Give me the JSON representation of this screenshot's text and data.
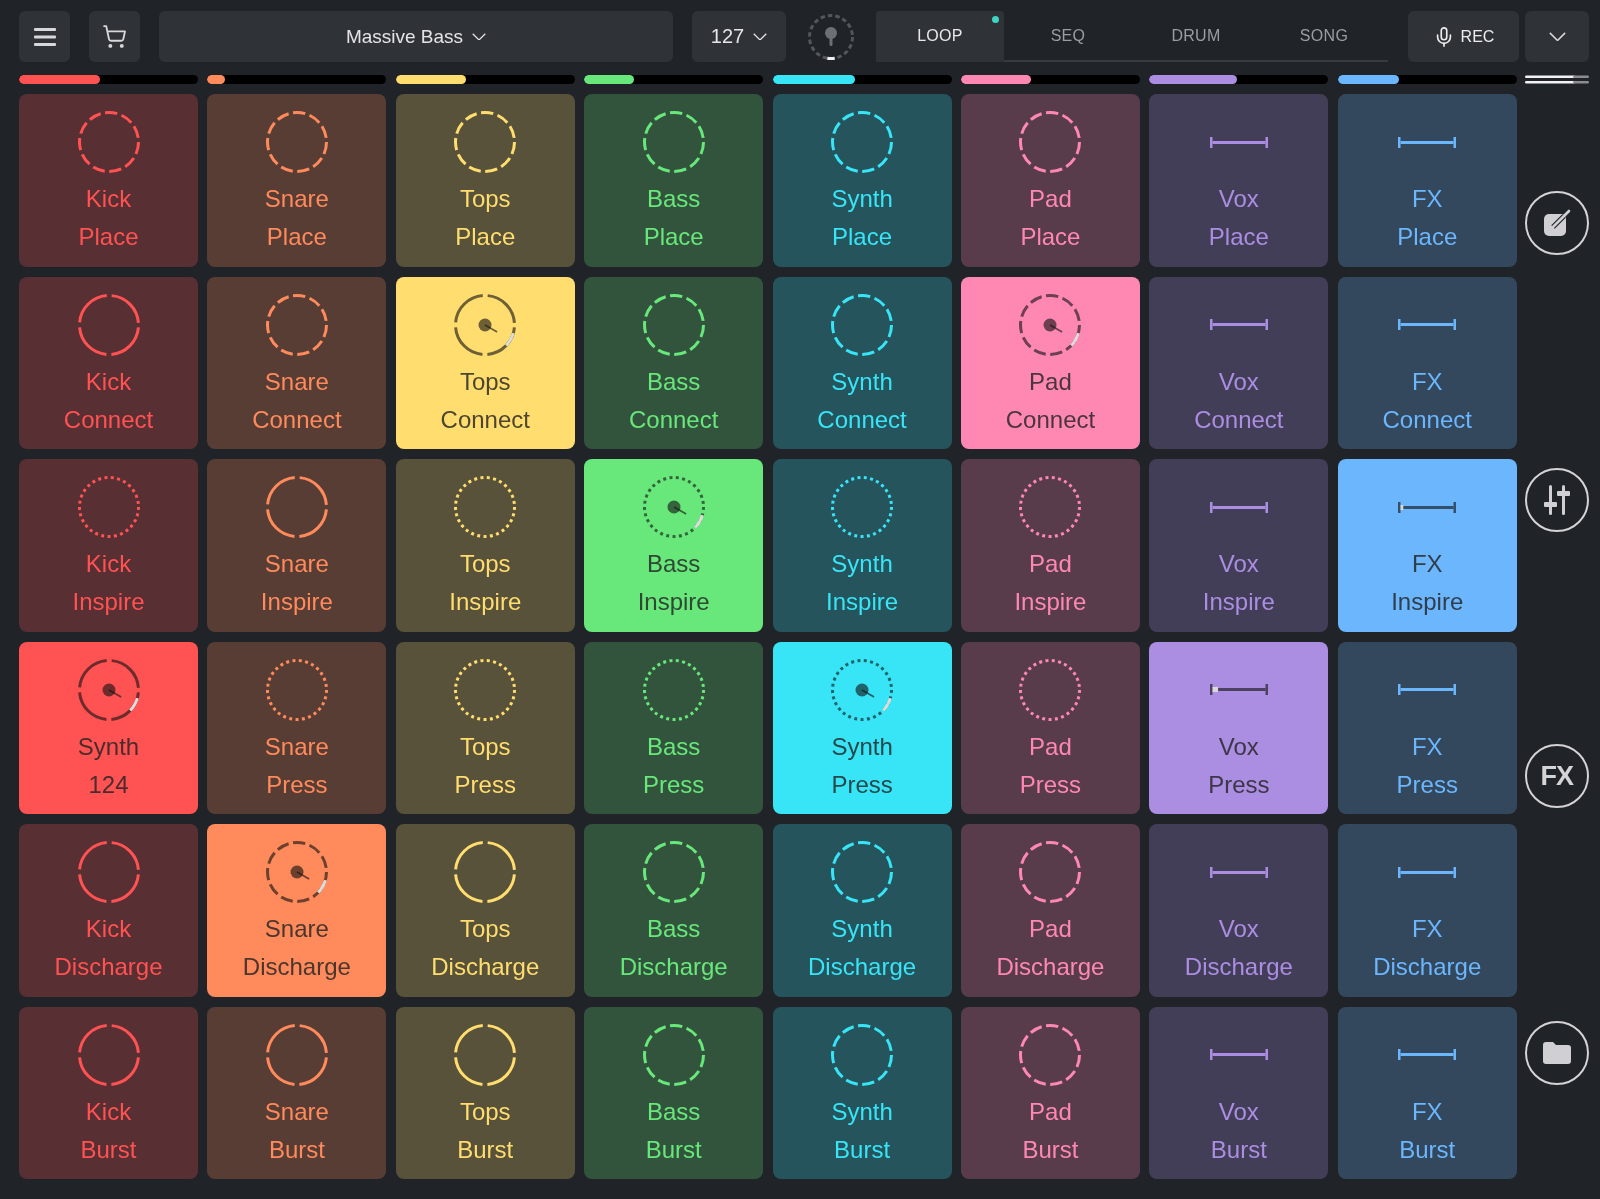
{
  "toolbar": {
    "preset": "Massive Bass",
    "tempo": "127",
    "tabs": [
      {
        "label": "LOOP",
        "selected": true,
        "notified": true
      },
      {
        "label": "SEQ",
        "selected": false,
        "notified": false
      },
      {
        "label": "DRUM",
        "selected": false,
        "notified": false
      },
      {
        "label": "SONG",
        "selected": false,
        "notified": false
      }
    ],
    "record": "REC"
  },
  "columns": [
    {
      "color": "#ff5252",
      "level": 0.45,
      "pads": [
        {
          "title": "Kick",
          "subtitle": "Place",
          "kind": "dashed",
          "selected": false
        },
        {
          "title": "Kick",
          "subtitle": "Connect",
          "kind": "arcs",
          "selected": false
        },
        {
          "title": "Kick",
          "subtitle": "Inspire",
          "kind": "dotted",
          "selected": false
        },
        {
          "title": "Synth",
          "subtitle": "124",
          "kind": "arcs",
          "selected": true
        },
        {
          "title": "Kick",
          "subtitle": "Discharge",
          "kind": "arcs",
          "selected": false
        },
        {
          "title": "Kick",
          "subtitle": "Burst",
          "kind": "arcs",
          "selected": false
        }
      ]
    },
    {
      "color": "#ff8a5b",
      "level": 0.1,
      "pads": [
        {
          "title": "Snare",
          "subtitle": "Place",
          "kind": "dashed",
          "selected": false
        },
        {
          "title": "Snare",
          "subtitle": "Connect",
          "kind": "dashed",
          "selected": false
        },
        {
          "title": "Snare",
          "subtitle": "Inspire",
          "kind": "arcs",
          "selected": false
        },
        {
          "title": "Snare",
          "subtitle": "Press",
          "kind": "dotted",
          "selected": false
        },
        {
          "title": "Snare",
          "subtitle": "Discharge",
          "kind": "dashed",
          "selected": true
        },
        {
          "title": "Snare",
          "subtitle": "Burst",
          "kind": "arcs",
          "selected": false
        }
      ]
    },
    {
      "color": "#ffdd6e",
      "level": 0.39,
      "pads": [
        {
          "title": "Tops",
          "subtitle": "Place",
          "kind": "dashed",
          "selected": false
        },
        {
          "title": "Tops",
          "subtitle": "Connect",
          "kind": "arcs",
          "selected": true
        },
        {
          "title": "Tops",
          "subtitle": "Inspire",
          "kind": "dotted",
          "selected": false
        },
        {
          "title": "Tops",
          "subtitle": "Press",
          "kind": "dotted",
          "selected": false
        },
        {
          "title": "Tops",
          "subtitle": "Discharge",
          "kind": "arcs",
          "selected": false
        },
        {
          "title": "Tops",
          "subtitle": "Burst",
          "kind": "arcs",
          "selected": false
        }
      ]
    },
    {
      "color": "#68e87b",
      "level": 0.28,
      "pads": [
        {
          "title": "Bass",
          "subtitle": "Place",
          "kind": "dashed",
          "selected": false
        },
        {
          "title": "Bass",
          "subtitle": "Connect",
          "kind": "dashed",
          "selected": false
        },
        {
          "title": "Bass",
          "subtitle": "Inspire",
          "kind": "dotted",
          "selected": true
        },
        {
          "title": "Bass",
          "subtitle": "Press",
          "kind": "dotted",
          "selected": false
        },
        {
          "title": "Bass",
          "subtitle": "Discharge",
          "kind": "dashed",
          "selected": false
        },
        {
          "title": "Bass",
          "subtitle": "Burst",
          "kind": "dashed",
          "selected": false
        }
      ]
    },
    {
      "color": "#37e5f7",
      "level": 0.46,
      "pads": [
        {
          "title": "Synth",
          "subtitle": "Place",
          "kind": "dashed",
          "selected": false
        },
        {
          "title": "Synth",
          "subtitle": "Connect",
          "kind": "dashed",
          "selected": false
        },
        {
          "title": "Synth",
          "subtitle": "Inspire",
          "kind": "dotted",
          "selected": false
        },
        {
          "title": "Synth",
          "subtitle": "Press",
          "kind": "dotted",
          "selected": true
        },
        {
          "title": "Synth",
          "subtitle": "Discharge",
          "kind": "dashed",
          "selected": false
        },
        {
          "title": "Synth",
          "subtitle": "Burst",
          "kind": "dashed",
          "selected": false
        }
      ]
    },
    {
      "color": "#ff88b3",
      "level": 0.39,
      "pads": [
        {
          "title": "Pad",
          "subtitle": "Place",
          "kind": "dashed",
          "selected": false
        },
        {
          "title": "Pad",
          "subtitle": "Connect",
          "kind": "dashed",
          "selected": true
        },
        {
          "title": "Pad",
          "subtitle": "Inspire",
          "kind": "dotted",
          "selected": false
        },
        {
          "title": "Pad",
          "subtitle": "Press",
          "kind": "dotted",
          "selected": false
        },
        {
          "title": "Pad",
          "subtitle": "Discharge",
          "kind": "dashed",
          "selected": false
        },
        {
          "title": "Pad",
          "subtitle": "Burst",
          "kind": "dashed",
          "selected": false
        }
      ]
    },
    {
      "color": "#ab8de2",
      "level": 0.49,
      "pads": [
        {
          "title": "Vox",
          "subtitle": "Place",
          "kind": "bar",
          "selected": false
        },
        {
          "title": "Vox",
          "subtitle": "Connect",
          "kind": "bar",
          "selected": false
        },
        {
          "title": "Vox",
          "subtitle": "Inspire",
          "kind": "bar",
          "selected": false
        },
        {
          "title": "Vox",
          "subtitle": "Press",
          "kind": "bar",
          "selected": true,
          "level": 0.1
        },
        {
          "title": "Vox",
          "subtitle": "Discharge",
          "kind": "bar",
          "selected": false
        },
        {
          "title": "Vox",
          "subtitle": "Burst",
          "kind": "bar",
          "selected": false
        }
      ]
    },
    {
      "color": "#6bb6fd",
      "level": 0.34,
      "pads": [
        {
          "title": "FX",
          "subtitle": "Place",
          "kind": "bar",
          "selected": false
        },
        {
          "title": "FX",
          "subtitle": "Connect",
          "kind": "bar",
          "selected": false
        },
        {
          "title": "FX",
          "subtitle": "Inspire",
          "kind": "bar",
          "selected": true,
          "level": 0.05
        },
        {
          "title": "FX",
          "subtitle": "Press",
          "kind": "bar",
          "selected": false
        },
        {
          "title": "FX",
          "subtitle": "Discharge",
          "kind": "bar",
          "selected": false
        },
        {
          "title": "FX",
          "subtitle": "Burst",
          "kind": "bar",
          "selected": false
        }
      ]
    }
  ],
  "sidebar": [
    {
      "kind": "edit"
    },
    {
      "kind": "mixer"
    },
    {
      "kind": "fx",
      "label": "FX"
    },
    {
      "kind": "folder"
    }
  ]
}
